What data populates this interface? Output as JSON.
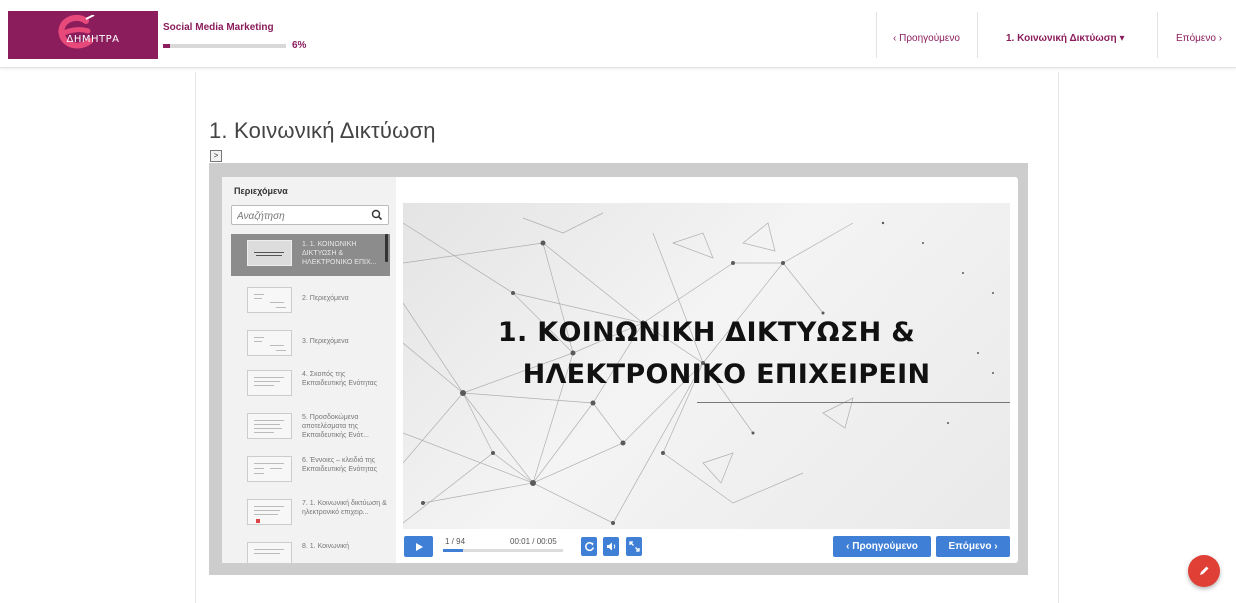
{
  "header": {
    "logo_text": "ΔΗΜΗΤΡΑ",
    "course_title": "Social Media Marketing",
    "progress_label": "6%",
    "progress_value": 0.06,
    "prev_label": "‹ Προηγούμενο",
    "section_label": "1. Κοινωνική Δικτύωση ▾",
    "next_label": "Επόμενο ›"
  },
  "lesson": {
    "title": "1. Κοινωνική Δικτύωση",
    "toggle_label": ">"
  },
  "sidebar": {
    "title": "Περιεχόμενα",
    "search_placeholder": "Αναζήτηση",
    "items": [
      {
        "label": "1. 1. ΚΟΙΝΩΝΙΚΗ ΔΙΚΤΥΩΣΗ & ΗΛΕΚΤΡΟΝΙΚΟ ΕΠΙΧ...",
        "active": true
      },
      {
        "label": "2. Περιεχόμενα",
        "active": false
      },
      {
        "label": "3. Περιεχόμενα",
        "active": false
      },
      {
        "label": "4. Σκοπός της Εκπαιδευτικής Ενότητας",
        "active": false
      },
      {
        "label": "5. Προσδοκώμενα αποτελέσματα της Εκπαιδευτικής Ενότ...",
        "active": false
      },
      {
        "label": "6. Έννοιες – κλειδιά της Εκπαιδευτικής Ενότητας",
        "active": false
      },
      {
        "label": "7. 1. Κοινωνική δικτύωση & ηλεκτρονικό επιχειρ...",
        "active": false
      },
      {
        "label": "8. 1. Κοινωνική",
        "active": false
      }
    ]
  },
  "slide": {
    "title_line1": "1. ΚΟΙΝΩΝΙΚΗ ΔΙΚΤΥΩΣΗ &",
    "title_line2": "ΗΛΕΚΤΡΟΝΙΚΟ ΕΠΙΧΕΙΡΕΙΝ"
  },
  "player": {
    "counter": "1 / 94",
    "time": "00:01 / 00:05",
    "seek_progress": 0.17,
    "prev_label": "‹ Προηγούμενο",
    "next_label": "Επόμενο ›"
  },
  "colors": {
    "brand": "#8b1d5c",
    "player_blue": "#3f7fd6",
    "fab": "#e03f35"
  }
}
